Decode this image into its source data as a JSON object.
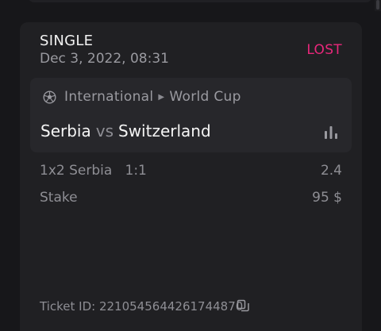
{
  "bet": {
    "type": "SINGLE",
    "date": "Dec 3, 2022, 08:31",
    "status": "LOST"
  },
  "event": {
    "sport_icon": "soccer-ball-icon",
    "league_parts": [
      "International",
      "World Cup"
    ],
    "home_team": "Serbia",
    "vs": "vs",
    "away_team": "Switzerland",
    "stats_icon": "bar-chart-icon"
  },
  "selection": {
    "market": "1x2",
    "pick": "Serbia",
    "score": "1:1",
    "odds": "2.4"
  },
  "stake": {
    "label": "Stake",
    "value": "95 $"
  },
  "ticket": {
    "label": "Ticket ID:",
    "id": "2210545644261744870",
    "copy_icon": "copy-icon"
  },
  "colors": {
    "background": "#17171a",
    "card": "#202023",
    "event_box": "#27272b",
    "status_lost": "#e8277a",
    "muted_text": "#8e8e94",
    "primary_text": "#f5f5f5"
  }
}
